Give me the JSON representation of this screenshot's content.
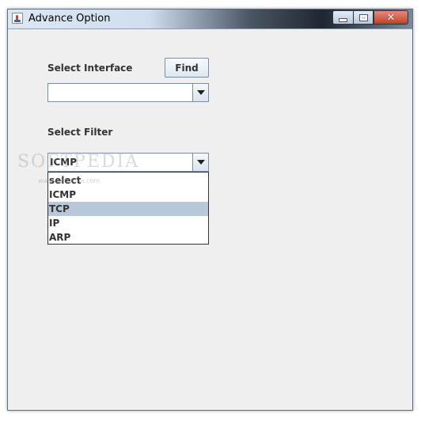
{
  "window": {
    "title": "Advance Option",
    "controls": {
      "close_glyph": "✕"
    }
  },
  "interface": {
    "label": "Select Interface",
    "find_label": "Find",
    "combo_value": ""
  },
  "filter": {
    "label": "Select Filter",
    "combo_value": "ICMP",
    "options": [
      "select",
      "ICMP",
      "TCP",
      "IP",
      "ARP"
    ],
    "highlighted_index": 2
  },
  "watermark": {
    "text": "SOFTPEDIA",
    "sub": "www.softpedia.com"
  },
  "colors": {
    "highlight": "#b8c8d9",
    "window_bg": "#efefef"
  }
}
